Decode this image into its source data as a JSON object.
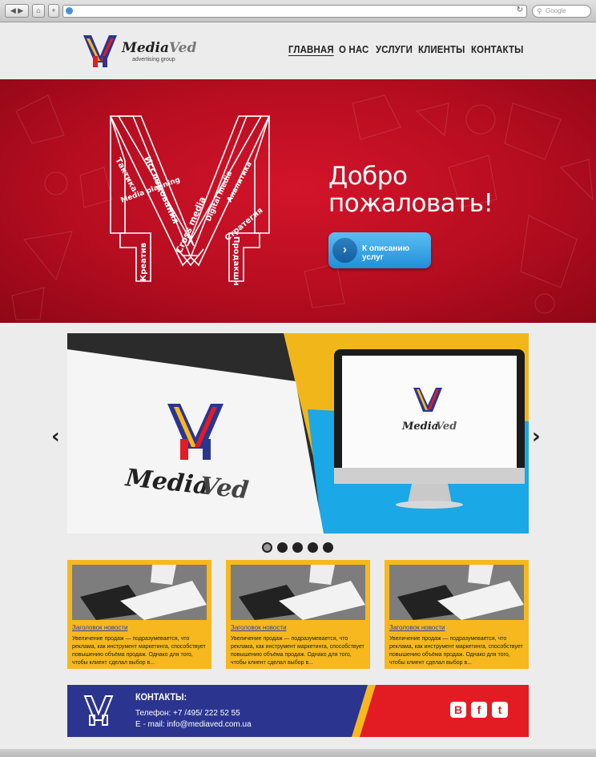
{
  "browser": {
    "search_placeholder": "Google",
    "nav_back_icon": "back-arrow-icon",
    "nav_forward_icon": "forward-arrow-icon"
  },
  "header": {
    "logo": {
      "name_main": "Media",
      "name_accent": "Ved",
      "tagline": "advertising group"
    },
    "nav": [
      {
        "label": "ГЛАВНАЯ",
        "active": true
      },
      {
        "label": "О НАС",
        "active": false
      },
      {
        "label": "УСЛУГИ",
        "active": false
      },
      {
        "label": "КЛИЕНТЫ",
        "active": false
      },
      {
        "label": "КОНТАКТЫ",
        "active": false
      }
    ]
  },
  "hero": {
    "title_line1": "Добро",
    "title_line2": "пожаловать!",
    "button_label": "К описанию услуг",
    "emblem_words": [
      "Тактика",
      "Исследования",
      "Cross media",
      "Digital media",
      "Аналитика",
      "Media planning",
      "Стратегия",
      "Креатив",
      "Продакшн"
    ],
    "colors": {
      "hero_red": "#c8102e",
      "button_blue": "#2b9be6"
    }
  },
  "slider": {
    "left_brand": {
      "main": "Media",
      "accent": "Ved"
    },
    "screen_brand": {
      "main": "Media",
      "accent": "Ved"
    },
    "active_index": 0,
    "slide_count": 5
  },
  "news": [
    {
      "title": "Заголовок новости",
      "text": "Увеличение продаж — подразумевается, что реклама, как инструмент маркетинга, способствует повышению объёма продаж. Однако для того, чтобы клиент сделал выбор в..."
    },
    {
      "title": "Заголовок новости",
      "text": "Увеличение продаж — подразумевается, что реклама, как инструмент маркетинга, способствует повышению объёма продаж. Однако для того, чтобы клиент сделал выбор в..."
    },
    {
      "title": "Заголовок новости",
      "text": "Увеличение продаж — подразумевается, что реклама, как инструмент маркетинга, способствует повышению объёма продаж. Однако для того, чтобы клиент сделал выбор в..."
    }
  ],
  "footer": {
    "title": "КОНТАКТЫ:",
    "phone": "Телефон: +7 /495/ 222 52  55",
    "email": "E - mail: info@mediaved.com.ua",
    "social": [
      {
        "name": "vkontakte-icon",
        "glyph": "B"
      },
      {
        "name": "facebook-icon",
        "glyph": "f"
      },
      {
        "name": "twitter-icon",
        "glyph": "t"
      }
    ],
    "colors": {
      "blue": "#2b3590",
      "yellow": "#f6b81e",
      "red": "#e31b23"
    }
  }
}
